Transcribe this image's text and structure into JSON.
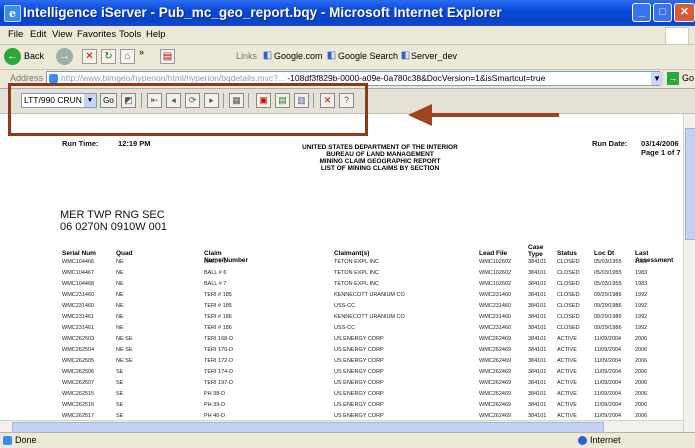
{
  "window": {
    "title": "Intelligence iServer - Pub_mc_geo_report.bqy - Microsoft Internet Explorer",
    "ie_icon_letter": "e"
  },
  "menu": {
    "items": [
      "File",
      "Edit",
      "View",
      "Favorites",
      "Tools",
      "Help"
    ]
  },
  "toolbar": {
    "back_label": "Back",
    "links_label": "Links",
    "link1": "Google.com",
    "link2": "Google Search",
    "link3": "Server_dev",
    "chevron": "»"
  },
  "address": {
    "label": "Address",
    "url_prefix": "http://www.blmgeo/hyperion/html/hyperion/bqdetails.mvc?...",
    "url_suffix": "-108df3f829b-0000-a09e-0a780c38&DocVersion=1&isSmartcut=true",
    "go_label": "Go"
  },
  "report_toolbar": {
    "printer_select": "LTT/990 CRUN",
    "go_button": "Go"
  },
  "report": {
    "run_time_label": "Run Time:",
    "run_time": "12:19 PM",
    "run_date_label": "Run Date:",
    "run_date": "03/14/2006",
    "page_info": "Page 1 of 7",
    "header_lines": [
      "UNITED STATES DEPARTMENT OF THE INTERIOR",
      "BUREAU OF LAND MANAGEMENT",
      "MINING CLAIM GEOGRAPHIC REPORT",
      "LIST OF MINING CLAIMS BY SECTION"
    ],
    "section_title": "MER TWP RNG SEC",
    "section_value": "06 0270N 0910W 001",
    "columns": [
      "Serial Num",
      "Quad",
      "Claim Name/Number",
      "Claimant(s)",
      "Lead File",
      "Case Type",
      "Status",
      "Loc Dt",
      "Last Assessment"
    ],
    "rows": [
      [
        "WMC104466",
        "NE",
        "BALL # 5",
        "TETON EXPL INC",
        "WMC102602",
        "384101",
        "CLOSED",
        "05/03/1955",
        "1983"
      ],
      [
        "WMC104467",
        "NE",
        "BALL # 6",
        "TETON EXPL INC",
        "WMC102602",
        "384101",
        "CLOSED",
        "05/03/1955",
        "1983"
      ],
      [
        "WMC104468",
        "NE",
        "BALL # 7",
        "TETON EXPL INC",
        "WMC102602",
        "384101",
        "CLOSED",
        "05/03/1955",
        "1983"
      ],
      [
        "WMC231460",
        "NE",
        "TERI # 185",
        "KENNECOTT URANIUM CO",
        "WMC231460",
        "384101",
        "CLOSED",
        "09/29/1986",
        "1992"
      ],
      [
        "WMC231460",
        "NE",
        "TERI # 185",
        "USS-CC",
        "WMC231460",
        "384101",
        "CLOSED",
        "09/29/1986",
        "1992"
      ],
      [
        "WMC231461",
        "NE",
        "TERI # 186",
        "KENNECOTT URANIUM CO",
        "WMC231460",
        "384101",
        "CLOSED",
        "09/29/1986",
        "1992"
      ],
      [
        "WMC231461",
        "NE",
        "TERI # 186",
        "USS-CC",
        "WMC231460",
        "384101",
        "CLOSED",
        "09/29/1986",
        "1992"
      ],
      [
        "WMC262503",
        "NE SE",
        "TERI 168-D",
        "US ENERGY CORP",
        "WMC262469",
        "384101",
        "ACTIVE",
        "11/09/2004",
        "2006"
      ],
      [
        "WMC262504",
        "NE SE",
        "TERI 170-D",
        "US ENERGY CORP",
        "WMC262469",
        "384101",
        "ACTIVE",
        "11/09/2004",
        "2006"
      ],
      [
        "WMC262505",
        "NE SE",
        "TERI 172-D",
        "US ENERGY CORP",
        "WMC262469",
        "384101",
        "ACTIVE",
        "11/09/2004",
        "2006"
      ],
      [
        "WMC262506",
        "SE",
        "TERI 174-D",
        "US ENERGY CORP",
        "WMC262469",
        "384101",
        "ACTIVE",
        "11/09/2004",
        "2006"
      ],
      [
        "WMC262507",
        "SE",
        "TERI 197-D",
        "US ENERGY CORP",
        "WMC262469",
        "384101",
        "ACTIVE",
        "11/09/2004",
        "2006"
      ],
      [
        "WMC262515",
        "SE",
        "PH 38-D",
        "US ENERGY CORP",
        "WMC262469",
        "384101",
        "ACTIVE",
        "11/09/2004",
        "2006"
      ],
      [
        "WMC262516",
        "SE",
        "PH 39-D",
        "US ENERGY CORP",
        "WMC262469",
        "384101",
        "ACTIVE",
        "11/09/2004",
        "2006"
      ],
      [
        "WMC262517",
        "SE",
        "PH 40-D",
        "US ENERGY CORP",
        "WMC262469",
        "384101",
        "ACTIVE",
        "11/09/2004",
        "2006"
      ]
    ]
  },
  "status": {
    "left": "Done",
    "zone": "Internet"
  },
  "colors": {
    "title_blue": "#0a48d8",
    "annotation_brown": "#a1431f",
    "highlight_border": "#8b3a1a"
  }
}
